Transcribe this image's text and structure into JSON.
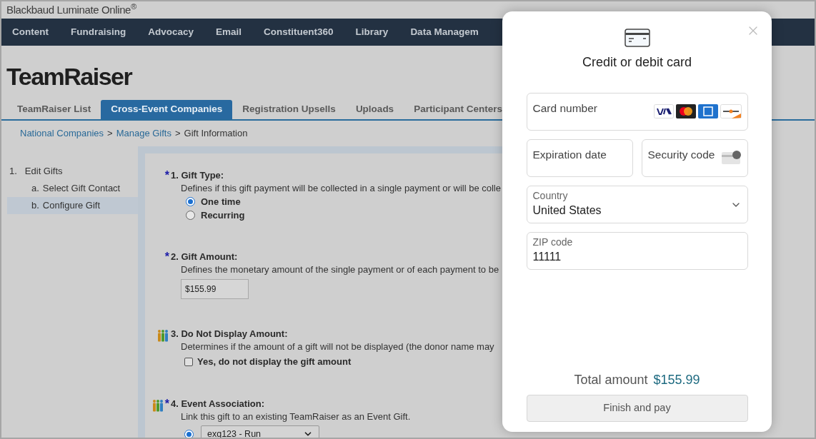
{
  "brand": "Blackbaud Luminate Online$^{®}$",
  "nav": [
    "Content",
    "Fundraising",
    "Advocacy",
    "Email",
    "Constituent360",
    "Library",
    "Data Managem"
  ],
  "title": "TeamRaiser",
  "tabs": [
    {
      "label": "TeamRaiser List",
      "selected": false
    },
    {
      "label": "Cross-Event Companies",
      "selected": true
    },
    {
      "label": "Registration Upsells",
      "selected": false
    },
    {
      "label": "Uploads",
      "selected": false
    },
    {
      "label": "Participant Centers",
      "selected": false
    }
  ],
  "breadcrumb": [
    {
      "label": "National Companies",
      "kind": "link"
    },
    {
      "label": ">",
      "kind": "separator"
    },
    {
      "label": "Manage Gifts",
      "kind": "link"
    },
    {
      "label": ">",
      "kind": "separator"
    },
    {
      "label": "Gift Information",
      "kind": "text"
    }
  ],
  "steps": [
    {
      "marker": "1.",
      "label": "Edit Gifts",
      "selected": false,
      "children": [
        {
          "marker": "a.",
          "label": "Select Gift Contact",
          "selected": false
        },
        {
          "marker": "b.",
          "label": "Configure Gift",
          "selected": true
        }
      ]
    }
  ],
  "sections": [
    {
      "kind": "radio",
      "required_mark": "*",
      "people_icon": false,
      "title": "1. Gift Type:",
      "description": "Defines if this gift payment will be collected in a single payment or will be colle",
      "options": [
        {
          "label": "One time",
          "selected": true
        },
        {
          "label": "Recurring",
          "selected": false
        }
      ]
    },
    {
      "kind": "amount",
      "required_mark": "*",
      "people_icon": false,
      "title": "2. Gift Amount:",
      "description": "Defines the monetary amount of the single payment or of each payment to be",
      "value": "$155.99"
    },
    {
      "kind": "checkbox",
      "people_icon": true,
      "title": "3. Do Not Display Amount:",
      "description": "Determines if the amount of a gift will not be displayed (the donor name may",
      "label": "Yes, do not display the gift amount",
      "checked": false
    },
    {
      "kind": "select",
      "required_mark": "*",
      "people_icon": true,
      "title": "4. Event Association:",
      "description": "Link this gift to an existing TeamRaiser as an Event Gift.",
      "selected": true,
      "value": "exg123 - Run"
    }
  ],
  "modal": {
    "title": "Credit or debit card",
    "card_number": {
      "label": "Card number"
    },
    "expiration": {
      "label": "Expiration date"
    },
    "security": {
      "label": "Security code"
    },
    "country": {
      "label": "Country",
      "value": "United States"
    },
    "zip": {
      "label": "ZIP code",
      "value": "11111"
    },
    "total_label": "Total amount",
    "total_value": "$155.99",
    "button": "Finish and pay"
  }
}
